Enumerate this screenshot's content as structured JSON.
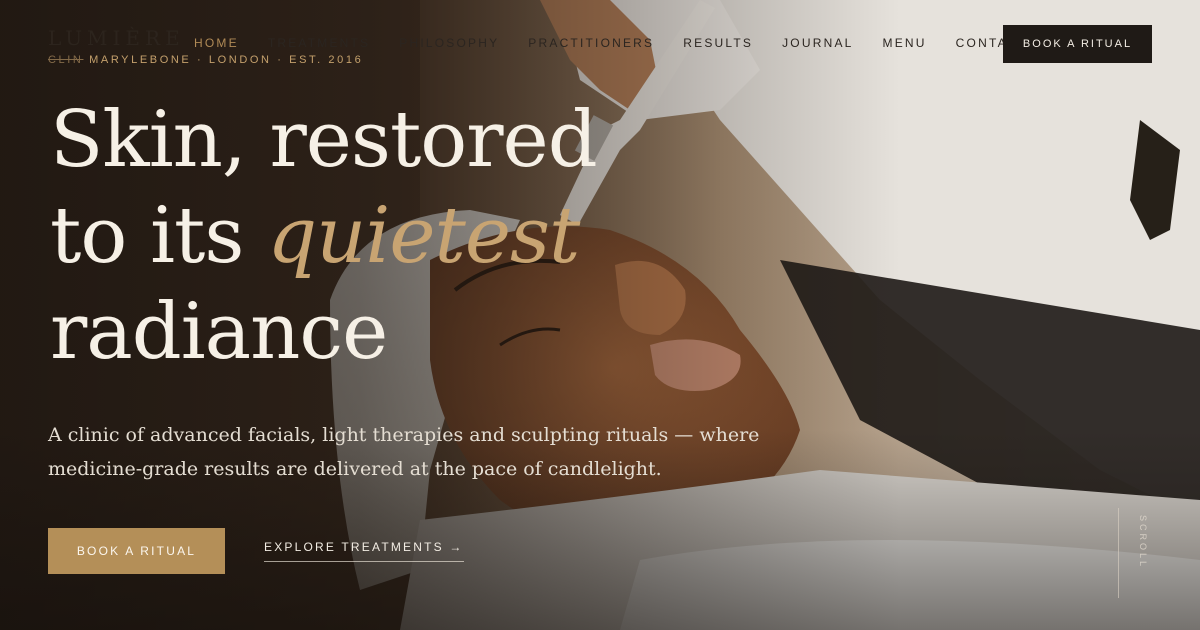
{
  "brand": {
    "name": "LUMIÈRE",
    "tagline_struck": "CLIN",
    "tagline": "MARYLEBONE · LONDON · EST. 2016"
  },
  "nav": {
    "items": [
      "HOME",
      "TREATMENTS",
      "PHILOSOPHY",
      "PRACTITIONERS",
      "RESULTS",
      "JOURNAL",
      "MENU",
      "CONTACT"
    ],
    "active": "HOME"
  },
  "header_cta": "BOOK A RITUAL",
  "hero": {
    "headline_line1": "Skin, restored",
    "headline_line2_prefix": "to its ",
    "headline_accent": "quietest",
    "headline_line3": "radiance",
    "lede": "A clinic of advanced facials, light therapies and sculpting rituals — where medicine-grade results are delivered at the pace of candlelight.",
    "primary_button": "BOOK A RITUAL",
    "secondary_link": "EXPLORE TREATMENTS →",
    "scroll_label": "SCROLL"
  },
  "colors": {
    "accent_gold": "#c8a472",
    "button_gold": "#b48f58",
    "dark": "#1f1a16",
    "cream": "#f6f0e6"
  }
}
